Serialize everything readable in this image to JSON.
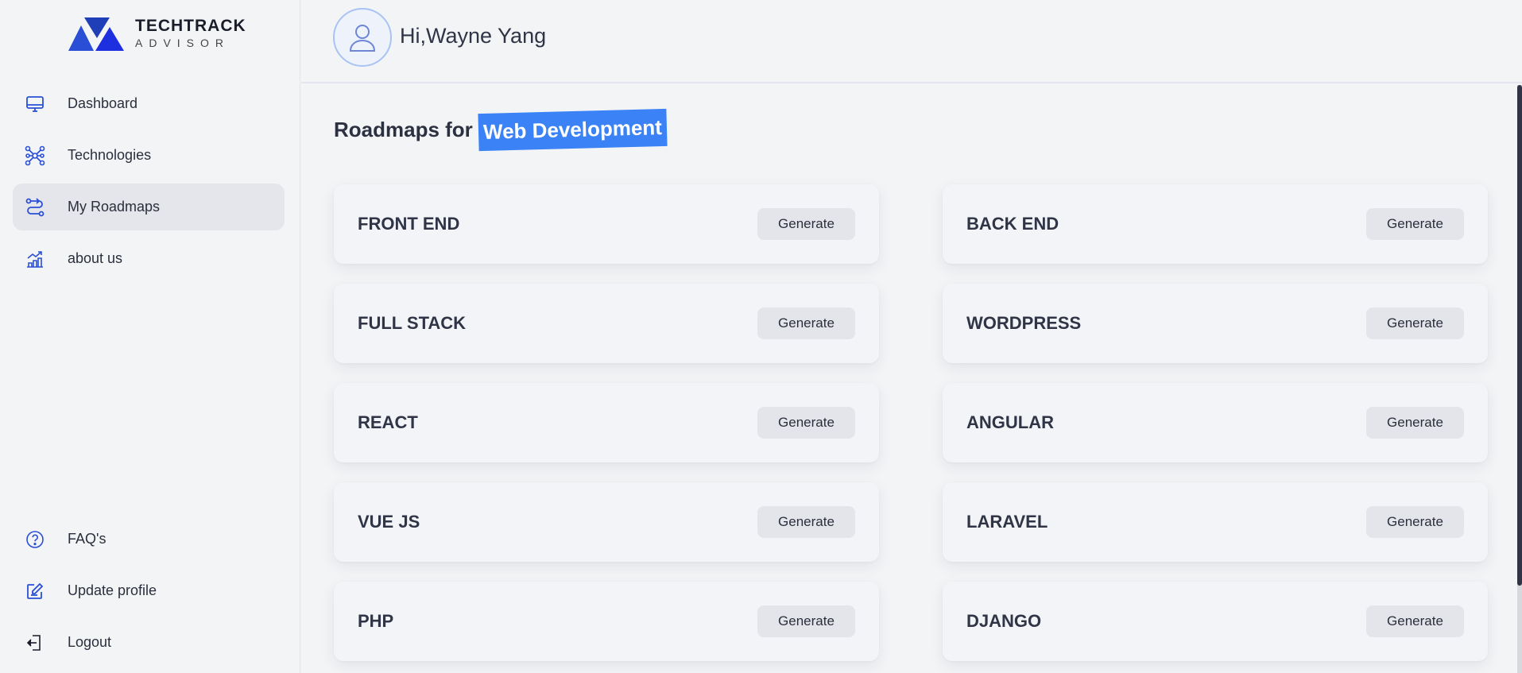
{
  "brand": {
    "title": "TECHTRACK",
    "subtitle": "ADVISOR"
  },
  "sidebar": {
    "top_items": [
      {
        "label": "Dashboard",
        "icon": "monitor-icon"
      },
      {
        "label": "Technologies",
        "icon": "nodes-icon"
      },
      {
        "label": "My Roadmaps",
        "icon": "route-icon",
        "active": true
      },
      {
        "label": "about us",
        "icon": "chart-icon"
      }
    ],
    "bottom_items": [
      {
        "label": "FAQ's",
        "icon": "question-icon"
      },
      {
        "label": "Update profile",
        "icon": "edit-icon"
      },
      {
        "label": "Logout",
        "icon": "logout-icon"
      }
    ]
  },
  "header": {
    "greeting": "Hi,Wayne Yang"
  },
  "main": {
    "heading_prefix": "Roadmaps for",
    "heading_highlight": "Web Development",
    "roadmaps": [
      {
        "title": "FRONT END",
        "button": "Generate"
      },
      {
        "title": "BACK END",
        "button": "Generate"
      },
      {
        "title": "FULL STACK",
        "button": "Generate"
      },
      {
        "title": "WORDPRESS",
        "button": "Generate"
      },
      {
        "title": "REACT",
        "button": "Generate"
      },
      {
        "title": "ANGULAR",
        "button": "Generate"
      },
      {
        "title": "VUE JS",
        "button": "Generate"
      },
      {
        "title": "LARAVEL",
        "button": "Generate"
      },
      {
        "title": "PHP",
        "button": "Generate"
      },
      {
        "title": "DJANGO",
        "button": "Generate"
      }
    ]
  },
  "colors": {
    "accent": "#3b82f6",
    "icon": "#2a4fd6",
    "text": "#2f3446",
    "background": "#f3f4f6"
  }
}
